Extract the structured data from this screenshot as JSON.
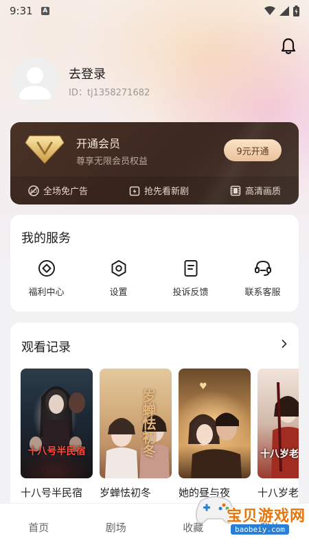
{
  "status_bar": {
    "time": "9:31",
    "notification_badge": "A"
  },
  "profile": {
    "login_label": "去登录",
    "user_id": "ID：tj1358271682"
  },
  "vip": {
    "title": "开通会员",
    "subtitle": "尊享无限会员权益",
    "button_label": "9元开通",
    "perks": [
      {
        "icon": "no-ads-icon",
        "label": "全场免广告"
      },
      {
        "icon": "early-access-icon",
        "label": "抢先看新剧"
      },
      {
        "icon": "film-icon",
        "label": "高清画质"
      }
    ]
  },
  "services": {
    "title": "我的服务",
    "items": [
      {
        "icon": "benefit-center-icon",
        "label": "福利中心"
      },
      {
        "icon": "settings-icon",
        "label": "设置"
      },
      {
        "icon": "feedback-icon",
        "label": "投诉反馈"
      },
      {
        "icon": "customer-service-icon",
        "label": "联系客服"
      }
    ]
  },
  "history": {
    "title": "观看记录",
    "items": [
      {
        "caption": "十八号半民宿",
        "poster_text": "十八号半民宿"
      },
      {
        "caption": "岁蝉怯初冬",
        "poster_text": "岁蝉怯初冬"
      },
      {
        "caption": "她的昼与夜",
        "poster_text": ""
      },
      {
        "caption": "十八岁老",
        "poster_text": "十八岁老"
      }
    ]
  },
  "tabbar": {
    "tabs": [
      "首页",
      "剧场",
      "收藏",
      "我的"
    ]
  },
  "watermark": {
    "text": "宝贝游戏网",
    "url": "baobeiy.com"
  },
  "colors": {
    "vip_card": "#3e2a22",
    "vip_button": "#f3d3ae",
    "watermark_orange": "#e8740c",
    "watermark_blue": "#2a7fd4"
  }
}
